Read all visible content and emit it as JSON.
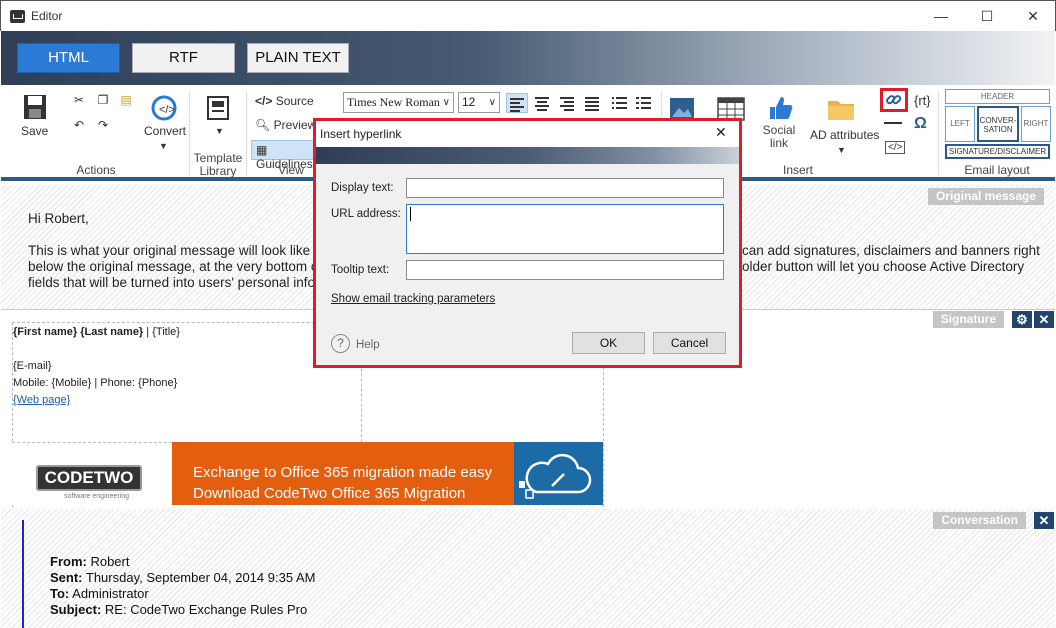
{
  "window": {
    "title": "Editor",
    "minimize": "—",
    "maximize": "☐",
    "close": "✕"
  },
  "formats": {
    "html": "HTML",
    "rtf": "RTF",
    "plain": "PLAIN TEXT"
  },
  "ribbon": {
    "actions": {
      "save": "Save",
      "convert": "Convert",
      "group": "Actions"
    },
    "template": {
      "label": "Template Library"
    },
    "view": {
      "source": "Source",
      "preview": "Preview",
      "guidelines": "Guidelines",
      "group": "View"
    },
    "font": {
      "family": "Times New Roman",
      "size": "12"
    },
    "insert": {
      "social": "Social link",
      "ad": "AD attributes",
      "group": "Insert",
      "rt": "{rt}",
      "omega": "Ω"
    },
    "email_layout": {
      "header": "HEADER",
      "left": "LEFT",
      "conversation": "CONVER-SATION",
      "right": "RIGHT",
      "sig": "SIGNATURE/DISCLAIMER",
      "group": "Email layout"
    }
  },
  "sections": {
    "original": {
      "tag": "Original message",
      "greeting": "Hi Robert,",
      "line1": "This is what your original message will look like to",
      "line1b": "can add signatures, disclaimers and banners right",
      "line2": "below the original message, at the very bottom of",
      "line2b": "older button will let you choose Active Directory",
      "line3": "fields that will be turned into users' personal inform"
    },
    "signature": {
      "tag": "Signature",
      "name": "{First name} {Last name}",
      "sep": " | ",
      "title": "{Title}",
      "email": "{E-mail}",
      "phones": "Mobile: {Mobile} | Phone: {Phone}",
      "web": "{Web page}",
      "banner": {
        "logo": "CODETWO",
        "logo_sub": "software engineering",
        "line1": "Exchange to Office 365 migration made easy",
        "line2": "Download CodeTwo Office 365 Migration"
      }
    },
    "conversation": {
      "tag": "Conversation",
      "from_label": "From:",
      "from": " Robert",
      "sent_label": "Sent:",
      "sent": " Thursday, September 04, 2014 9:35 AM",
      "to_label": "To:",
      "to": " Administrator",
      "subject_label": "Subject:",
      "subject": " RE: CodeTwo Exchange Rules Pro"
    }
  },
  "dialog": {
    "title": "Insert hyperlink",
    "display_label": "Display text:",
    "display_value": "",
    "url_label": "URL address:",
    "url_value": "",
    "tooltip_label": "Tooltip text:",
    "tooltip_value": "",
    "tracking_link": "Show email tracking parameters",
    "help": "Help",
    "ok": "OK",
    "cancel": "Cancel"
  },
  "colors": {
    "accent": "#2b7ad6",
    "highlight": "#dc1e2a",
    "banner_orange": "#e35e0e",
    "banner_blue": "#1c6aa6"
  }
}
